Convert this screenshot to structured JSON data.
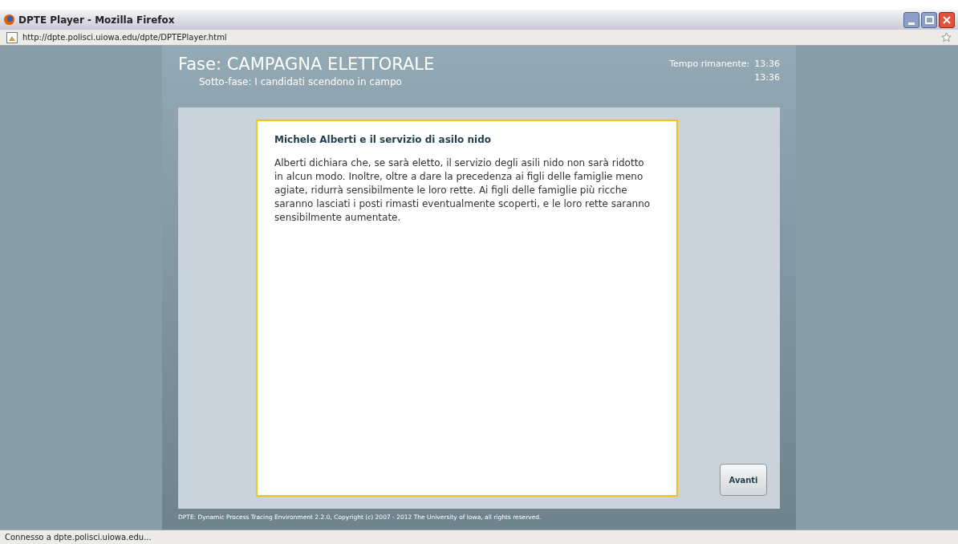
{
  "window": {
    "title": "DPTE Player - Mozilla Firefox"
  },
  "address_bar": {
    "url": "http://dpte.polisci.uiowa.edu/dpte/DPTEPlayer.html"
  },
  "header": {
    "phase": "Fase: CAMPAGNA ELETTORALE",
    "subphase": "Sotto-fase: I candidati scendono in campo",
    "timer_label": "Tempo rimanente:",
    "timer_value": "13:36",
    "timer_value_2": "13:36"
  },
  "article": {
    "title": "Michele Alberti e il servizio di asilo nido",
    "body": "Alberti dichiara che, se sarà eletto, il servizio degli asili nido non sarà ridotto in alcun modo. Inoltre, oltre a dare la precedenza ai figli delle famiglie meno agiate, ridurrà sensibilmente le loro rette. Ai figli delle famiglie più ricche saranno lasciati i posti rimasti eventualmente scoperti, e le loro rette saranno sensibilmente aumentate."
  },
  "next_button": "Avanti",
  "footer": "DPTE:  Dynamic Process Tracing Environment 2.2.0, Copyright (c) 2007 - 2012 The University of Iowa, all rights reserved.",
  "status_bar": "Connesso a dpte.polisci.uiowa.edu..."
}
